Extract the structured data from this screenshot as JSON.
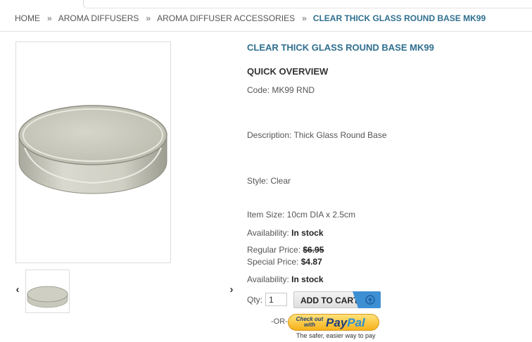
{
  "breadcrumb": {
    "items": [
      "HOME",
      "AROMA DIFFUSERS",
      "AROMA DIFFUSER ACCESSORIES"
    ],
    "separator": "»",
    "current": "CLEAR THICK GLASS ROUND BASE MK99"
  },
  "product": {
    "title": "CLEAR THICK GLASS ROUND BASE MK99",
    "overview_heading": "QUICK OVERVIEW",
    "code": "Code: MK99 RND",
    "description": "Description: Thick Glass Round Base",
    "style": "Style: Clear",
    "item_size": "Item Size: 10cm DIA x 2.5cm",
    "availability_label": "Availability:",
    "availability_value": "In stock",
    "regular_price_label": "Regular Price:",
    "regular_price": "$6.95",
    "special_price_label": "Special Price:",
    "special_price": "$4.87"
  },
  "gallery": {
    "prev_icon": "‹",
    "next_icon": "›"
  },
  "cart": {
    "qty_label": "Qty:",
    "qty_value": "1",
    "add_label": "ADD TO CART",
    "or_label": "-OR-",
    "paypal_small": "Check out with",
    "paypal_pay": "Pay",
    "paypal_pal": "Pal",
    "paypal_tagline": "The safer, easier way to pay"
  },
  "colors": {
    "accent": "#2f6f8f",
    "cart_icon_bg": "#3d8fd4",
    "paypal_yellow": "#f6b21a"
  }
}
